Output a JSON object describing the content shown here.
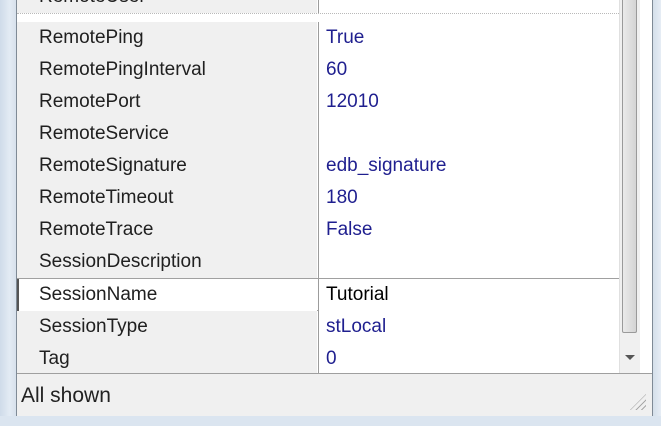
{
  "properties": [
    {
      "name": "RemoteUser",
      "value": ""
    },
    {
      "name": "RemotePing",
      "value": "True"
    },
    {
      "name": "RemotePingInterval",
      "value": "60"
    },
    {
      "name": "RemotePort",
      "value": "12010"
    },
    {
      "name": "RemoteService",
      "value": ""
    },
    {
      "name": "RemoteSignature",
      "value": "edb_signature"
    },
    {
      "name": "RemoteTimeout",
      "value": "180"
    },
    {
      "name": "RemoteTrace",
      "value": "False"
    },
    {
      "name": "SessionDescription",
      "value": ""
    },
    {
      "name": "SessionName",
      "value": "Tutorial"
    },
    {
      "name": "SessionType",
      "value": "stLocal"
    },
    {
      "name": "Tag",
      "value": "0"
    }
  ],
  "status": {
    "text": "All shown"
  },
  "icons": {
    "scroll_down": "chevron-down-icon",
    "resize": "resize-grip-icon"
  }
}
